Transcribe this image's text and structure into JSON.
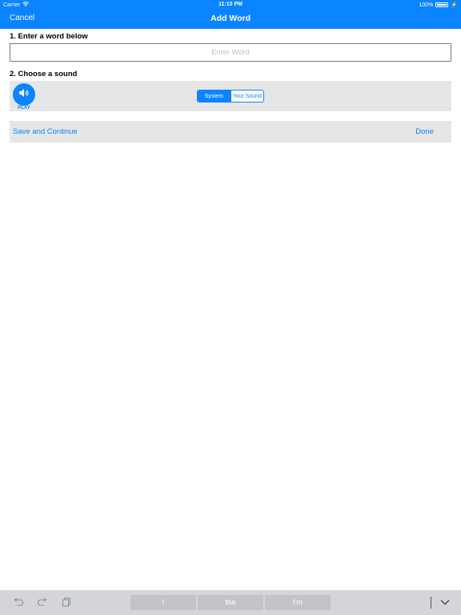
{
  "status_bar": {
    "carrier": "Carrier",
    "time": "11:10 PM",
    "battery": "100%"
  },
  "nav": {
    "cancel_label": "Cancel",
    "title": "Add Word"
  },
  "form": {
    "step1_label": "1. Enter a word below",
    "word_input": {
      "value": "",
      "placeholder": "Enter Word"
    },
    "step2_label": "2. Choose a sound",
    "play_label": "PLAY",
    "sound_source": {
      "options": [
        "System",
        "Your Sound"
      ],
      "selected": "System"
    }
  },
  "actions": {
    "save_continue_label": "Save and Continue",
    "done_label": "Done"
  },
  "keyboard_bar": {
    "suggestions": [
      "I",
      "the",
      "I'm"
    ]
  },
  "colors": {
    "accent": "#0a84ff",
    "panel_bg": "#e6e6e6",
    "keyboard_bg": "#d3d5da"
  }
}
